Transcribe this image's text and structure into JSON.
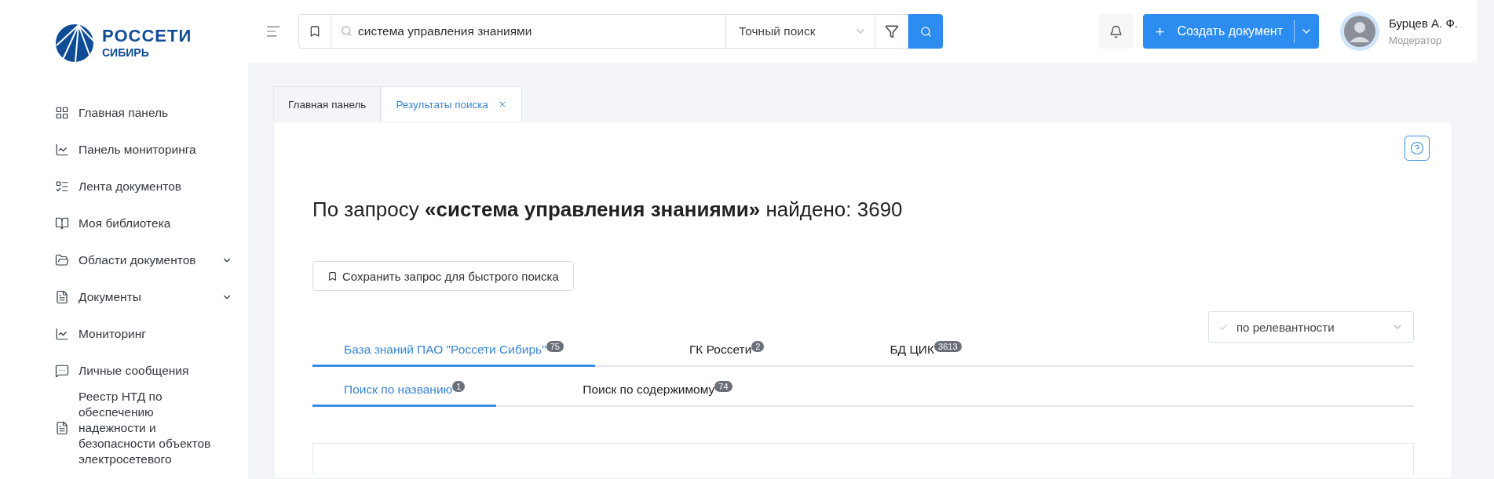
{
  "logo": {
    "name": "РОССЕТИ",
    "region": "СИБИРЬ"
  },
  "sidebar": {
    "items": [
      {
        "label": "Главная панель",
        "expandable": false
      },
      {
        "label": "Панель мониторинга",
        "expandable": false
      },
      {
        "label": "Лента документов",
        "expandable": false
      },
      {
        "label": "Моя библиотека",
        "expandable": false
      },
      {
        "label": "Области документов",
        "expandable": true
      },
      {
        "label": "Документы",
        "expandable": true
      },
      {
        "label": "Мониторинг",
        "expandable": false
      },
      {
        "label": "Личные сообщения",
        "expandable": false
      },
      {
        "label": "Реестр НТД по обеспечению надежности и безопасности объектов электросетевого",
        "expandable": false
      }
    ]
  },
  "topbar": {
    "search": {
      "value": "система управления знаниями",
      "mode": "Точный поиск"
    },
    "create_button": {
      "label": "Создать документ"
    },
    "user": {
      "name": "Бурцев А. Ф.",
      "role": "Модератор"
    }
  },
  "tabs": [
    {
      "label": "Главная панель",
      "selected": false,
      "closable": false
    },
    {
      "label": "Результаты поиска",
      "selected": true,
      "closable": true
    }
  ],
  "results": {
    "heading": "По запросу **«система управления знаниями»** найдено: 3690",
    "save_button": "Сохранить запрос для быстрого поиска",
    "sort": {
      "value": "по релевантности"
    },
    "source_tabs": [
      {
        "label": "База знаний ПАО \"Россети Сибирь\"",
        "count": "75",
        "selected": true
      },
      {
        "label": "ГК Россети",
        "count": "2",
        "selected": false
      },
      {
        "label": "БД ЦИК",
        "count": "3613",
        "selected": false
      }
    ],
    "search_tabs": [
      {
        "label": "Поиск по названию",
        "count": "1",
        "selected": true
      },
      {
        "label": "Поиск по содержимому",
        "count": "74",
        "selected": false
      }
    ]
  }
}
